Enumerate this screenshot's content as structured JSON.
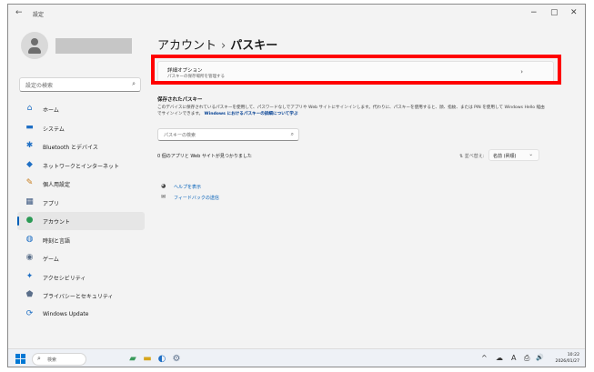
{
  "window": {
    "back_glyph": "←",
    "title": "設定",
    "controls": {
      "minimize": "−",
      "maximize": "▢",
      "close": "✕"
    }
  },
  "sidebar": {
    "search_placeholder": "設定の検索",
    "items": [
      {
        "label": "ホーム",
        "icon": "home-icon",
        "glyph": "⌂",
        "color": "#1f6fc4",
        "active": false
      },
      {
        "label": "システム",
        "icon": "system-icon",
        "glyph": "▬",
        "color": "#1f6fc4",
        "active": false
      },
      {
        "label": "Bluetooth とデバイス",
        "icon": "bluetooth-icon",
        "glyph": "✱",
        "color": "#1f6fc4",
        "active": false
      },
      {
        "label": "ネットワークとインターネット",
        "icon": "network-icon",
        "glyph": "◆",
        "color": "#1f6fc4",
        "active": false
      },
      {
        "label": "個人用設定",
        "icon": "brush-icon",
        "glyph": "✎",
        "color": "#c77b1a",
        "active": false
      },
      {
        "label": "アプリ",
        "icon": "apps-icon",
        "glyph": "▦",
        "color": "#3f5a82",
        "active": false
      },
      {
        "label": "アカウント",
        "icon": "account-icon",
        "glyph": "●",
        "color": "#2b9a55",
        "active": true
      },
      {
        "label": "時刻と言語",
        "icon": "globe-clock-icon",
        "glyph": "◍",
        "color": "#1f6fc4",
        "active": false
      },
      {
        "label": "ゲーム",
        "icon": "gamepad-icon",
        "glyph": "◉",
        "color": "#5b6f8a",
        "active": false
      },
      {
        "label": "アクセシビリティ",
        "icon": "accessibility-icon",
        "glyph": "✦",
        "color": "#1f6fc4",
        "active": false
      },
      {
        "label": "プライバシーとセキュリティ",
        "icon": "shield-icon",
        "glyph": "⬟",
        "color": "#5b6f8a",
        "active": false
      },
      {
        "label": "Windows Update",
        "icon": "update-icon",
        "glyph": "⟳",
        "color": "#1f6fc4",
        "active": false
      }
    ]
  },
  "main": {
    "breadcrumb_parent": "アカウント",
    "breadcrumb_sep": "›",
    "breadcrumb_current": "パスキー",
    "advanced": {
      "title": "詳細オプション",
      "subtitle": "パスキーの保存場所を管理する",
      "chevron": "›"
    },
    "saved_heading": "保存されたパスキー",
    "description": "このデバイスに保存されているパスキーを使用して、パスワードなしでアプリや Web サイトにサインインします。代わりに、パスキーを使用すると、顔、指紋、または PIN を使用して Windows Hello 経由でサインインできます。",
    "description_link": "Windows におけるパスキーの詳細について学ぶ",
    "search_placeholder": "パスキーの検索",
    "found_text": "0 個のアプリと Web サイトが見つかりました",
    "sort_label": "並べ替え:",
    "sort_value": "名前 (昇順)",
    "sort_chevron": "⌄",
    "help_links": [
      {
        "label": "ヘルプを表示",
        "icon": "help-icon",
        "glyph": "◕"
      },
      {
        "label": "フィードバックの送信",
        "icon": "feedback-icon",
        "glyph": "✉"
      }
    ]
  },
  "taskbar": {
    "search_placeholder": "検索",
    "time": "10:22",
    "date": "2026/01/27",
    "tray": [
      "^",
      "☁",
      "A",
      "⎙",
      "🔊"
    ]
  },
  "colors": {
    "accent": "#005fb8",
    "highlight_box": "#ff0000"
  }
}
